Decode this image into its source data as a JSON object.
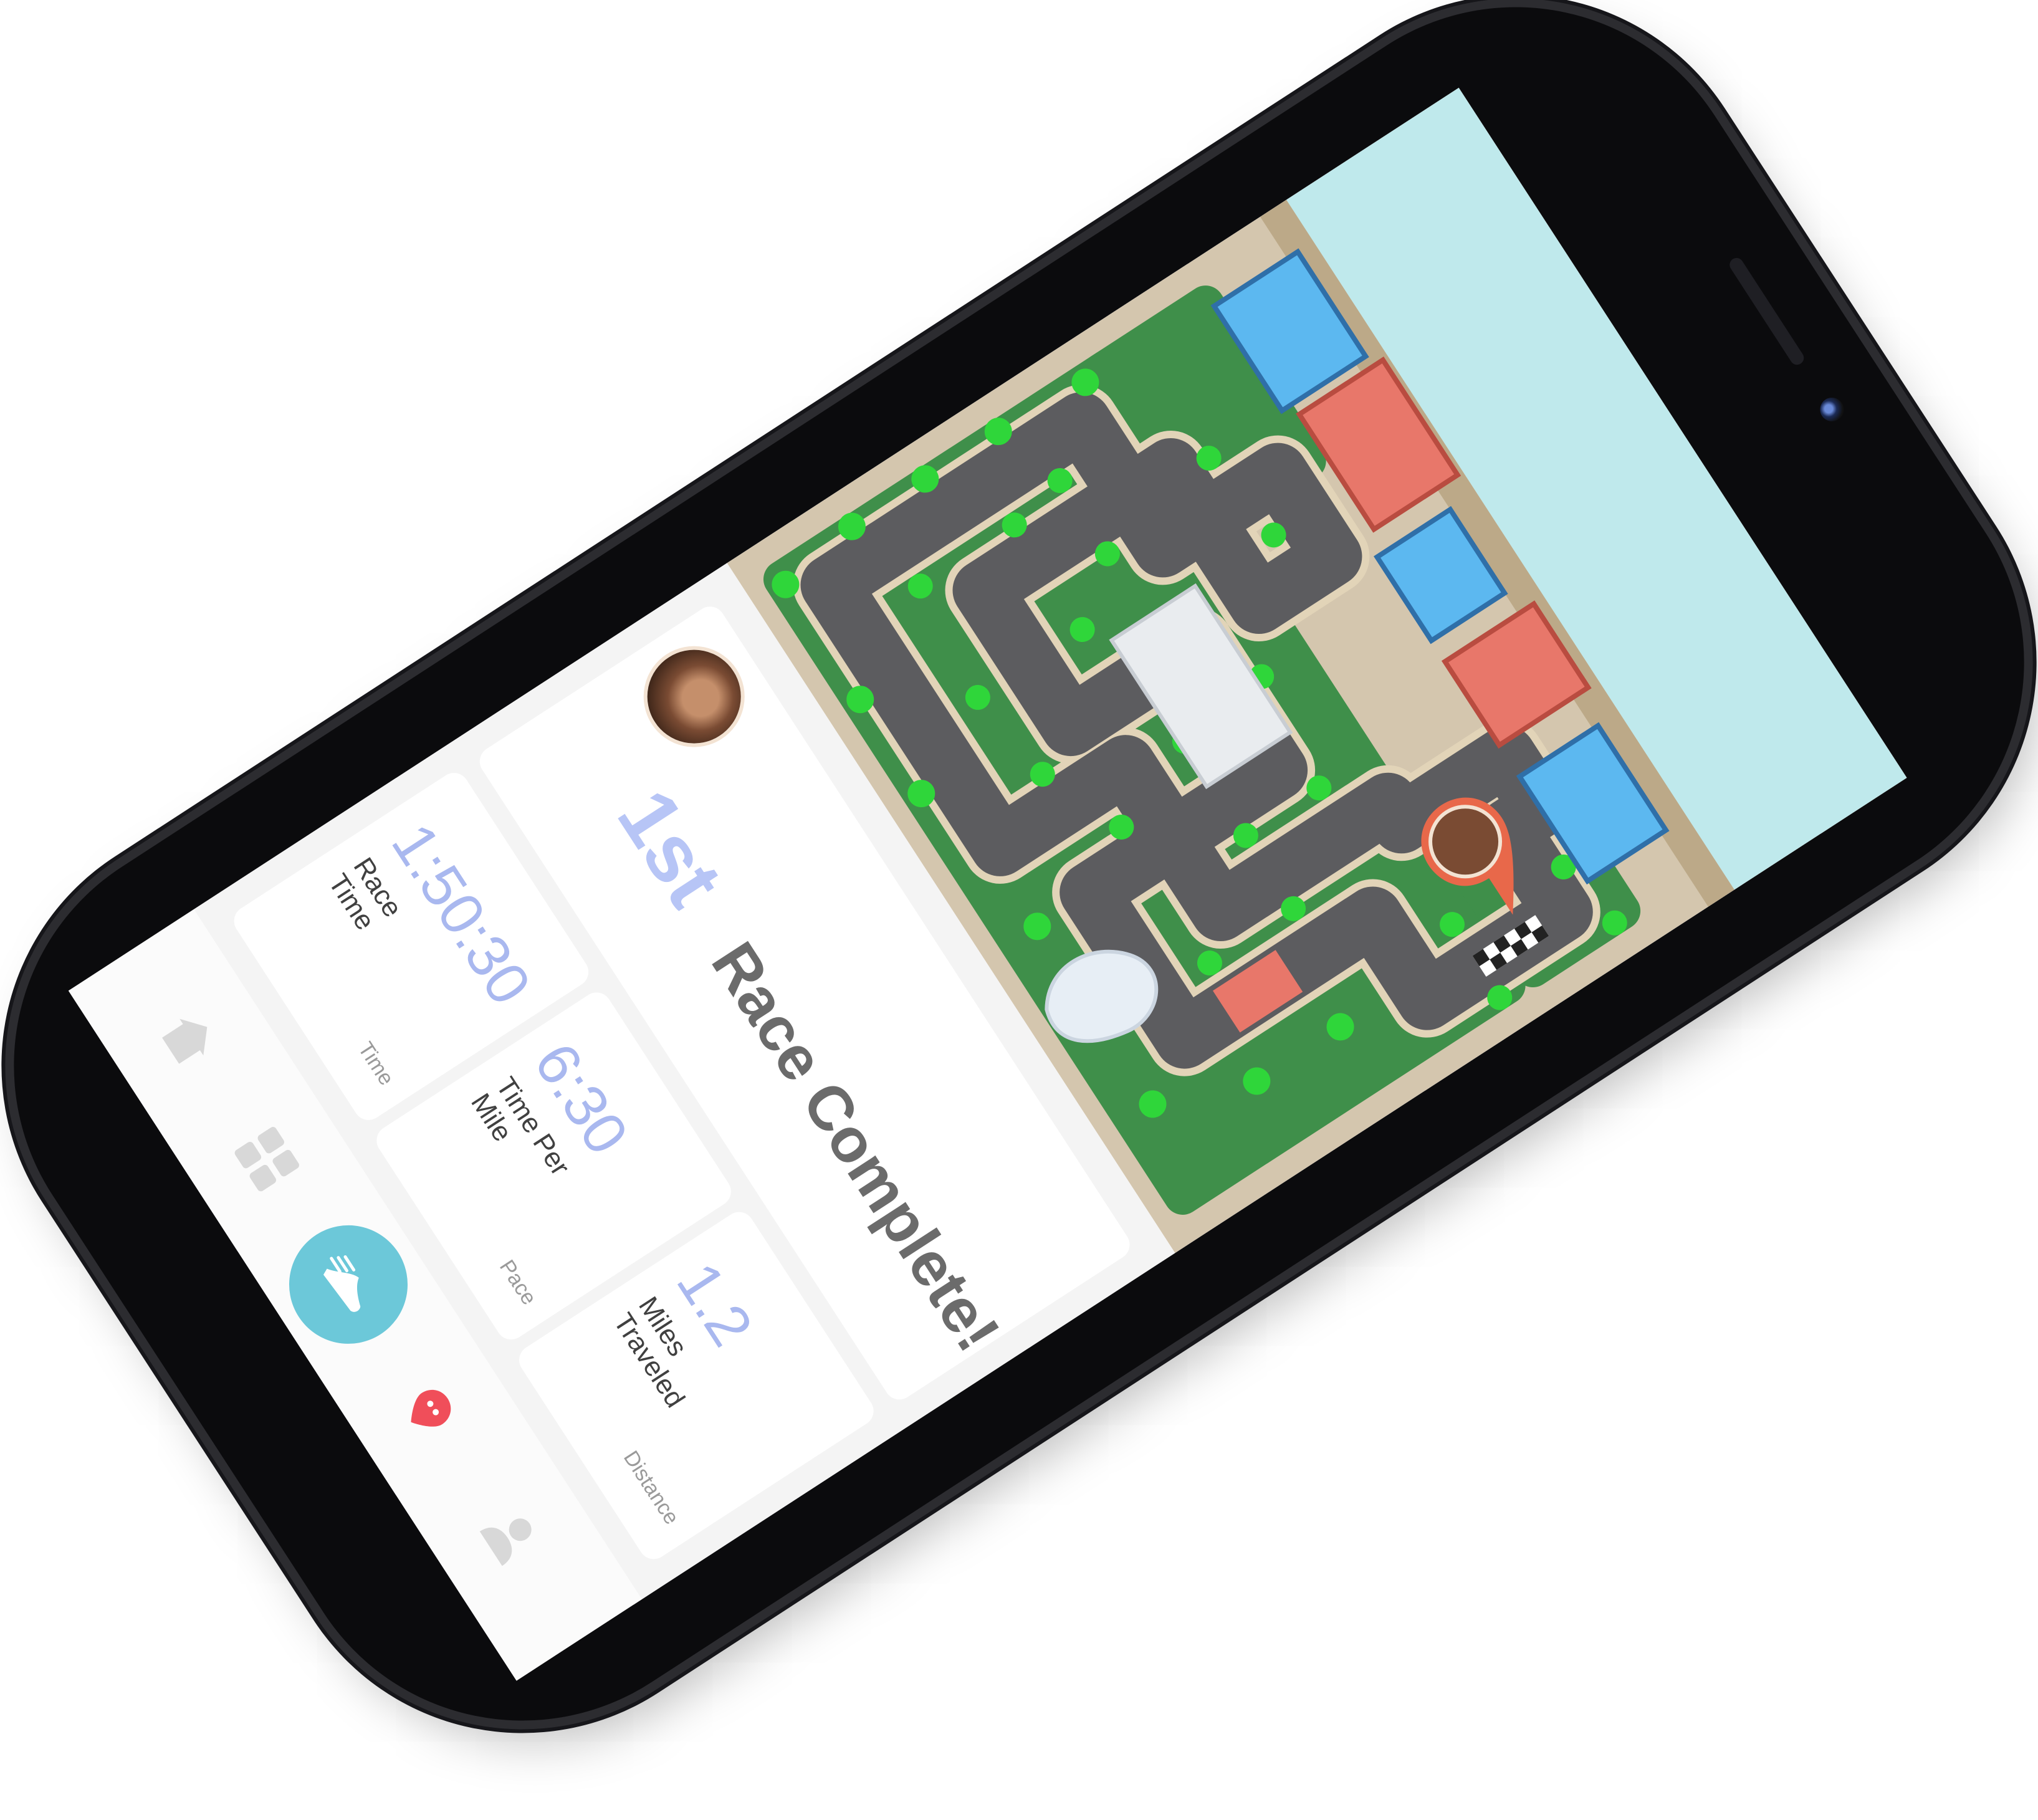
{
  "nav": {
    "items": [
      {
        "name": "home",
        "icon": "home-icon",
        "active": false
      },
      {
        "name": "dashboard",
        "icon": "grid-icon",
        "active": false
      },
      {
        "name": "run",
        "icon": "running-shoe-icon",
        "active": true
      },
      {
        "name": "pin",
        "icon": "location-pin-icon",
        "active": false
      },
      {
        "name": "profile",
        "icon": "user-icon",
        "active": false
      }
    ],
    "accent_color": "#6cc8d9",
    "pin_color": "#f04e5a"
  },
  "result": {
    "place": "1st",
    "title": "Race Complete!"
  },
  "stats": [
    {
      "caption": "Time",
      "value": "1:50:30",
      "label": "Race Time"
    },
    {
      "caption": "Pace",
      "value": "6:30",
      "label": "Time Per Mile"
    },
    {
      "caption": "Distance",
      "value": "1.2",
      "label": "Miles Traveled"
    }
  ],
  "map": {
    "track_color": "#5c5c5f",
    "grass_color": "#3f8f4a",
    "tree_color": "#2fd63a",
    "water_color": "#bfe9ec",
    "sand_color": "#d4c6ae",
    "building_colors": [
      "#5cb8f0",
      "#e8776a",
      "#e9ecef"
    ]
  }
}
